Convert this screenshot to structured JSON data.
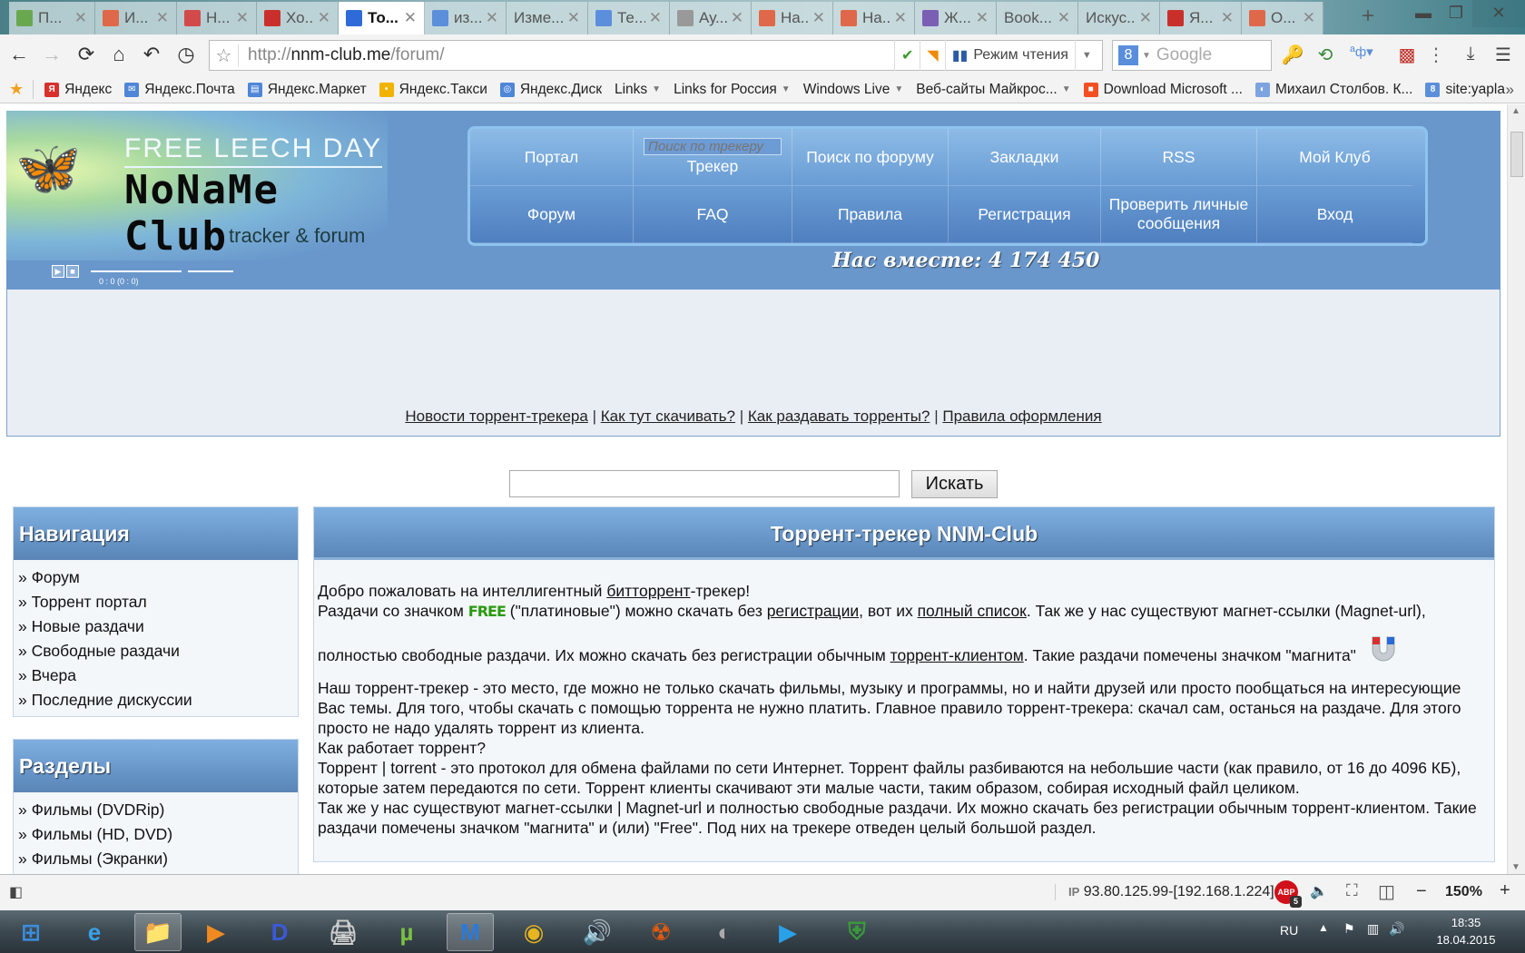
{
  "browser": {
    "tabs": [
      {
        "label": "П...",
        "icon": "undo-green-icon",
        "color": "#6aa84f",
        "active": false
      },
      {
        "label": "И...",
        "icon": "hand-pointer-icon",
        "color": "#e0684a",
        "active": false
      },
      {
        "label": "Н...",
        "icon": "youtube-icon",
        "color": "#d24a4a",
        "active": false
      },
      {
        "label": "Хо...",
        "icon": "yandex-ya-icon",
        "color": "#c9302c",
        "active": false
      },
      {
        "label": "То...",
        "icon": "butterfly-icon",
        "color": "#2f6bd8",
        "active": true
      },
      {
        "label": "из...",
        "icon": "google-g-icon",
        "color": "#5b8fdc",
        "active": false
      },
      {
        "label": "Изме...",
        "icon": "",
        "color": "",
        "active": false
      },
      {
        "label": "Те...",
        "icon": "google-g-icon",
        "color": "#5b8fdc",
        "active": false
      },
      {
        "label": "Ау...",
        "icon": "microphone-icon",
        "color": "#999",
        "active": false
      },
      {
        "label": "На...",
        "icon": "hand-pointer-icon",
        "color": "#e0684a",
        "active": false
      },
      {
        "label": "На...",
        "icon": "hand-pointer-icon",
        "color": "#e0684a",
        "active": false
      },
      {
        "label": "Ж...",
        "icon": "clock-purple-icon",
        "color": "#7a5fb5",
        "active": false
      },
      {
        "label": "Book...",
        "icon": "",
        "color": "",
        "active": false
      },
      {
        "label": "Искус...",
        "icon": "",
        "color": "",
        "active": false
      },
      {
        "label": "Я...",
        "icon": "yandex-ya-icon",
        "color": "#c9302c",
        "active": false
      },
      {
        "label": "О...",
        "icon": "hand-pointer-icon",
        "color": "#e0684a",
        "active": false
      }
    ],
    "new_tab_label": "+",
    "url_prefix": "http://",
    "url_host": "nnm-club.me",
    "url_path": "/forum/",
    "reader_mode_label": "Режим чтения",
    "search_placeholder": "Google",
    "bookmarks": [
      {
        "label": "Яндекс",
        "color": "#d9302c",
        "glyph": "Я",
        "dropdown": false
      },
      {
        "label": "Яндекс.Почта",
        "color": "#4e86d8",
        "glyph": "✉",
        "dropdown": false
      },
      {
        "label": "Яндекс.Маркет",
        "color": "#4e86d8",
        "glyph": "▤",
        "dropdown": false
      },
      {
        "label": "Яндекс.Такси",
        "color": "#f2b300",
        "glyph": "•",
        "dropdown": false
      },
      {
        "label": "Яндекс.Диск",
        "color": "#4e86d8",
        "glyph": "◎",
        "dropdown": false
      },
      {
        "label": "Links",
        "color": "",
        "glyph": "",
        "dropdown": true
      },
      {
        "label": "Links for Россия",
        "color": "",
        "glyph": "",
        "dropdown": true
      },
      {
        "label": "Windows Live",
        "color": "",
        "glyph": "",
        "dropdown": true
      },
      {
        "label": "Веб-сайты Майкрос...",
        "color": "",
        "glyph": "",
        "dropdown": true
      },
      {
        "label": "Download Microsoft ...",
        "color": "#f25022",
        "glyph": "■",
        "dropdown": false
      },
      {
        "label": "Михаил Столбов. К...",
        "color": "#7da4e0",
        "glyph": "◐",
        "dropdown": false
      },
      {
        "label": "site:yapla",
        "color": "#5b8fdc",
        "glyph": "8",
        "dropdown": false
      }
    ],
    "bookmarks_overflow": "»",
    "status": {
      "ip_label": "IP",
      "ip_value": "93.80.125.99-[192.168.1.224]",
      "abp_label": "ABP",
      "abp_count": "5",
      "zoom_minus": "−",
      "zoom_level": "150%",
      "zoom_plus": "+"
    }
  },
  "site": {
    "logo": {
      "banner": "FREE LEECH DAY",
      "name": "NoNaMe Club",
      "tagline": "tracker & forum"
    },
    "player": {
      "time": "0 : 0    (0 : 0)"
    },
    "menu": [
      {
        "label": "Портал"
      },
      {
        "label": "Трекер",
        "search_placeholder": "Поиск по трекеру"
      },
      {
        "label": "Поиск по форуму"
      },
      {
        "label": "Закладки"
      },
      {
        "label": "RSS"
      },
      {
        "label": "Мой Клуб"
      },
      {
        "label": "Форум"
      },
      {
        "label": "FAQ"
      },
      {
        "label": "Правила"
      },
      {
        "label": "Регистрация"
      },
      {
        "label": "Проверить личные сообщения"
      },
      {
        "label": "Вход"
      }
    ],
    "together_label": "Нас вместе: 4 174 450",
    "top_links": [
      "Новости торрент-трекера",
      "Как тут скачивать?",
      "Как раздавать торренты?",
      "Правила оформления"
    ],
    "top_links_separator": " | ",
    "search_button": "Искать",
    "nav_box": {
      "title": "Навигация",
      "items": [
        "Форум",
        "Торрент портал",
        "Новые раздачи",
        "Свободные раздачи",
        "Вчера",
        "Последние дискуссии"
      ]
    },
    "sections_box": {
      "title": "Разделы",
      "items": [
        "Фильмы (DVDRip)",
        "Фильмы (HD, DVD)",
        "Фильмы (Экранки)"
      ]
    },
    "bullet": "» ",
    "main": {
      "title": "Торрент-трекер NNM-Club",
      "p1_a": "Добро пожаловать на интеллигентный ",
      "p1_link": "битторрент",
      "p1_b": "-трекер!",
      "p2_a": "Раздачи со значком ",
      "p2_free": "FREE",
      "p2_b": " (\"платиновые\") можно скачать без ",
      "p2_link1": "регистрации",
      "p2_c": ", вот их ",
      "p2_link2": "полный список",
      "p2_d": ". Так же у нас существуют магнет-ссылки (Magnet-url),",
      "p3_a": "полностью свободные раздачи. Их можно скачать без регистрации обычным ",
      "p3_link": "торрент-клиентом",
      "p3_b": ". Такие раздачи помечены значком \"магнита\"",
      "p4": "Наш торрент-трекер - это место, где можно не только скачать фильмы, музыку и программы, но и найти друзей или просто пообщаться на интересующие Вас темы. Для того, чтобы скачать с помощью торрента не нужно платить. Главное правило торрент-трекера: скачал сам, останься на раздаче. Для этого просто не надо удалять торрент из клиента.",
      "p5": "Как работает торрент?",
      "p6": "Торрент | torrent - это протокол для обмена файлами по сети Интернет. Торрент файлы разбиваются на небольшие части (как правило, от 16 до 4096 КБ), которые затем передаются по сети. Торрент клиенты скачивают эти малые части, таким образом, собирая исходный файл целиком.",
      "p7": "Так же у нас существуют магнет-ссылки | Magnet-url и полностью свободные раздачи. Их можно скачать без регистрации обычным торрент-клиентом. Такие раздачи помечены значком \"магнита\" и (или) \"Free\". Под них на трекере отведен целый большой раздел."
    }
  },
  "taskbar": {
    "apps": [
      "windows-start",
      "internet-explorer",
      "file-explorer",
      "media-player",
      "daemon-tools",
      "scanner",
      "utorrent",
      "maxthon",
      "chrome",
      "volume-app",
      "radiation-app",
      "game-app",
      "media-player-blue",
      "shield-app"
    ],
    "lang": "RU",
    "time": "18:35",
    "date": "18.04.2015"
  }
}
